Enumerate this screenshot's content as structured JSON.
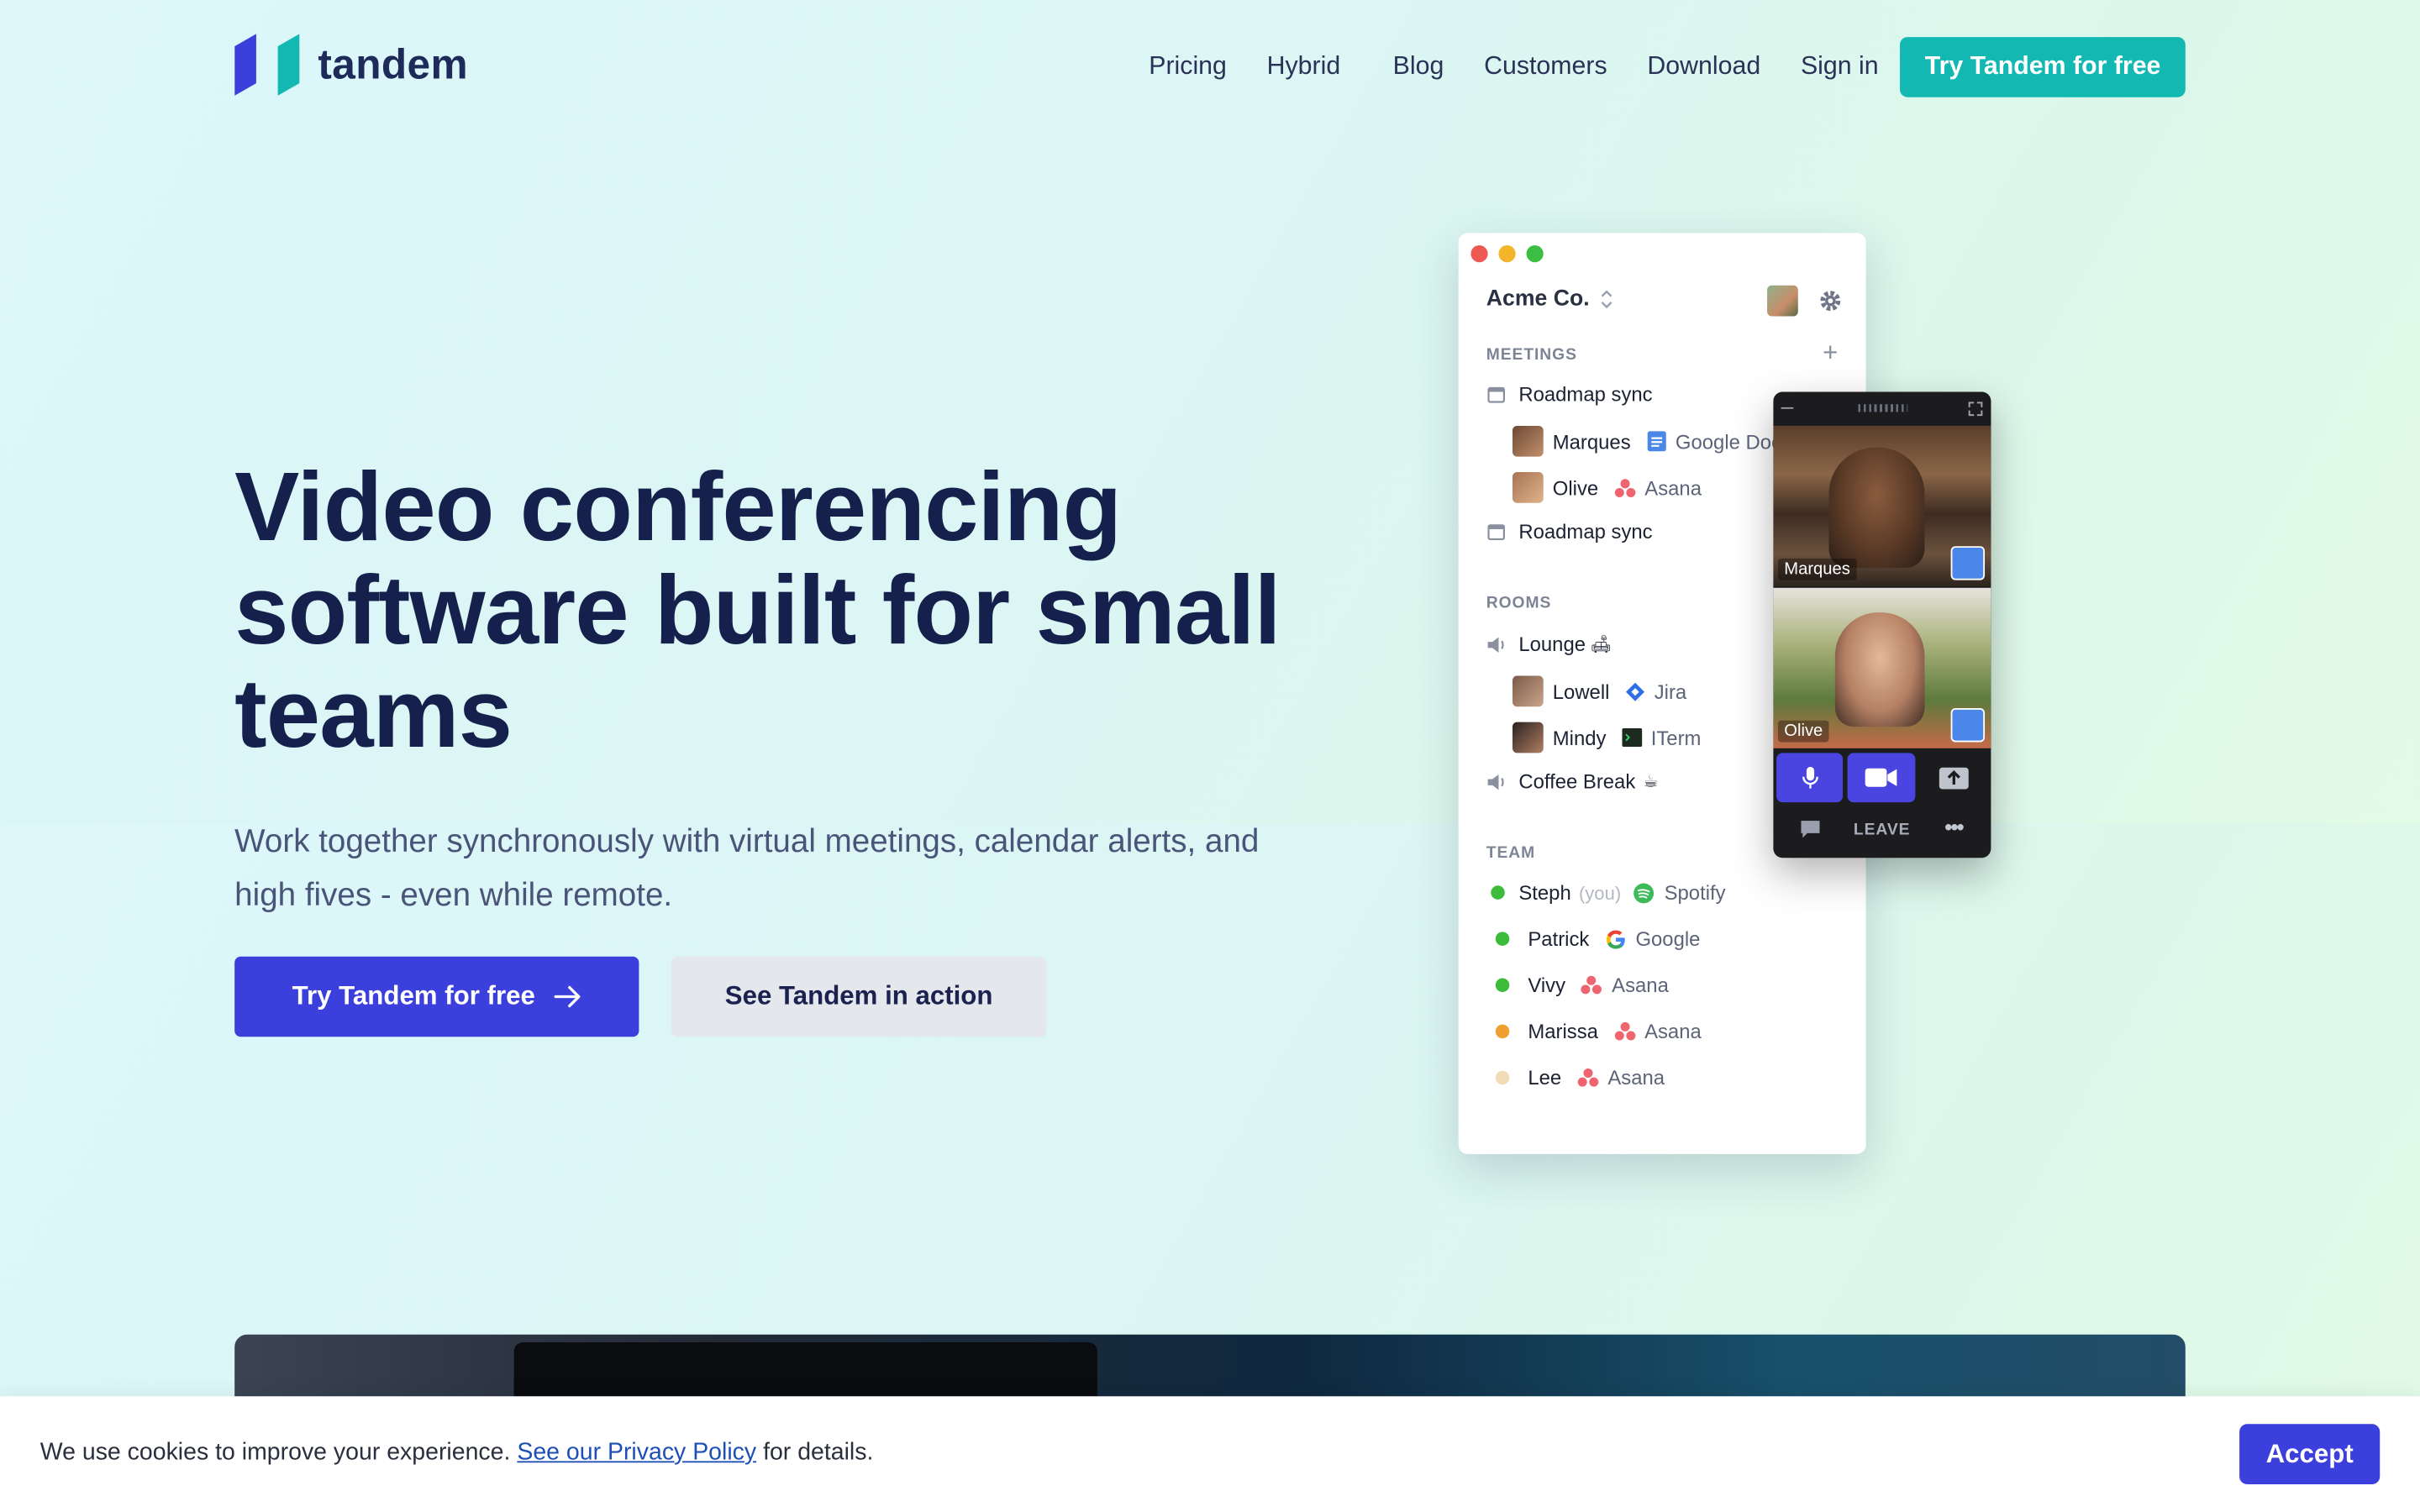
{
  "brand": {
    "name": "tandem",
    "colors": {
      "primary": "#3b3fdb",
      "teal": "#13b8b3",
      "navy": "#15204c"
    }
  },
  "nav": {
    "links": [
      "Pricing",
      "Hybrid",
      "Blog",
      "Customers",
      "Download",
      "Sign in"
    ],
    "cta": "Try Tandem for free"
  },
  "hero": {
    "title": "Video conferencing software built for small teams",
    "subtitle": "Work together synchronously with virtual meetings, calendar alerts, and high fives - even while remote.",
    "primary_button": "Try Tandem for free",
    "secondary_button": "See Tandem in action"
  },
  "app": {
    "org": "Acme Co.",
    "meetings_title": "MEETINGS",
    "meetings": [
      {
        "name": "Roadmap sync",
        "participants": [
          {
            "name": "Marques",
            "app": "Google Docs",
            "app_icon": "google-docs-icon"
          },
          {
            "name": "Olive",
            "app": "Asana",
            "app_icon": "asana-icon"
          }
        ]
      },
      {
        "name": "Roadmap sync",
        "participants": []
      }
    ],
    "rooms_title": "ROOMS",
    "rooms": [
      {
        "name": "Lounge",
        "emoji": "🛋",
        "participants": [
          {
            "name": "Lowell",
            "app": "Jira",
            "app_icon": "jira-icon"
          },
          {
            "name": "Mindy",
            "app": "ITerm",
            "app_icon": "terminal-icon"
          }
        ]
      },
      {
        "name": "Coffee Break",
        "emoji": "☕",
        "participants": []
      }
    ],
    "team_title": "TEAM",
    "team": [
      {
        "name": "Steph",
        "suffix": "(you)",
        "app": "Spotify",
        "status_color": "#3dbb3a"
      },
      {
        "name": "Patrick",
        "suffix": "",
        "app": "Google",
        "status_color": "#3dbb3a"
      },
      {
        "name": "Vivy",
        "suffix": "",
        "app": "Asana",
        "status_color": "#3dbb3a"
      },
      {
        "name": "Marissa",
        "suffix": "",
        "app": "Asana",
        "status_color": "#f0a030"
      },
      {
        "name": "Lee",
        "suffix": "",
        "app": "Asana",
        "status_color": "#f2dcb8"
      }
    ]
  },
  "video_call": {
    "participants": [
      "Marques",
      "Olive"
    ],
    "leave_label": "LEAVE"
  },
  "cookie": {
    "text_before": "We use cookies to improve your experience.",
    "link": "See our Privacy Policy",
    "text_after": "for details.",
    "accept": "Accept"
  }
}
